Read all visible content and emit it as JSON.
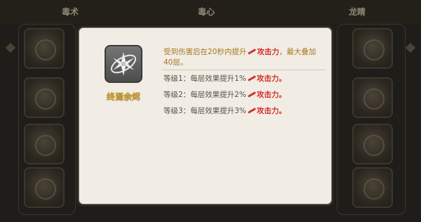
{
  "background_tabs": [
    "毒术",
    "毒心",
    "龙睛"
  ],
  "skill": {
    "name": "终焉余烬",
    "icon": "snowflake-crystal-icon"
  },
  "description": {
    "before_value": "受到伤害后在20秒内提升",
    "stat": "攻击力",
    "after_value": "，最大叠加40层。"
  },
  "levels": [
    {
      "label": "等级1：",
      "text": "每层效果提升1%",
      "stat": "攻击力",
      "end": "。"
    },
    {
      "label": "等级2：",
      "text": "每层效果提升2%",
      "stat": "攻击力",
      "end": "。"
    },
    {
      "label": "等级3：",
      "text": "每层效果提升3%",
      "stat": "攻击力",
      "end": "。"
    }
  ],
  "colors": {
    "gold": "#c99a2a",
    "stat_red": "#d2302a",
    "panel": "#f1ede5"
  }
}
